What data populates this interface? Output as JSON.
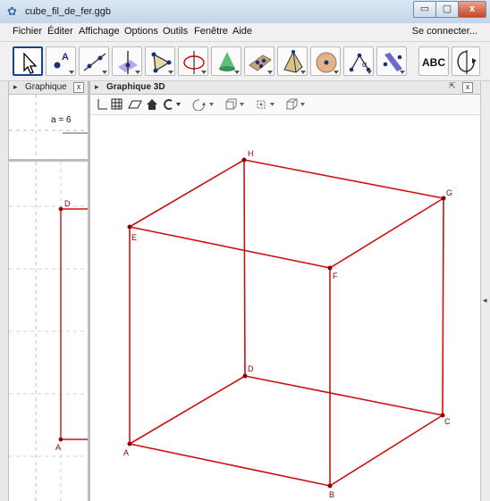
{
  "window": {
    "title": "cube_fil_de_fer.ggb",
    "buttons": {
      "minimize": "▭",
      "maximize": "▢",
      "close": "x"
    }
  },
  "menu": {
    "items": [
      "Fichier",
      "Éditer",
      "Affichage",
      "Options",
      "Outils",
      "Fenêtre",
      "Aide"
    ],
    "connect": "Se connecter..."
  },
  "toolbar": {
    "tools": [
      {
        "icon": "move-arrow-icon",
        "selected": true
      },
      {
        "icon": "point-icon",
        "label": "A"
      },
      {
        "icon": "line-icon"
      },
      {
        "icon": "perpendicular-line-icon"
      },
      {
        "icon": "polygon-icon"
      },
      {
        "icon": "circle-axis-icon"
      },
      {
        "icon": "cone-icon"
      },
      {
        "icon": "plane-icon"
      },
      {
        "icon": "pyramid-icon"
      },
      {
        "icon": "sphere-icon"
      },
      {
        "icon": "angle-icon",
        "label": "α"
      },
      {
        "icon": "reflect-plane-icon"
      },
      {
        "icon": "text-icon",
        "label": "ABC"
      },
      {
        "icon": "rotate-view-icon"
      }
    ]
  },
  "algebra_panel": {
    "title": "Graphique",
    "close": "x",
    "slider_label": "a = 6"
  },
  "graphics3d": {
    "title": "Graphique 3D",
    "accent_color": "#cc0000"
  },
  "graphics2d": {
    "points": [
      "D",
      "A"
    ]
  },
  "cube": {
    "vertices": [
      "A",
      "B",
      "C",
      "D",
      "E",
      "F",
      "G",
      "H"
    ],
    "edge_color": "#cc1111"
  }
}
